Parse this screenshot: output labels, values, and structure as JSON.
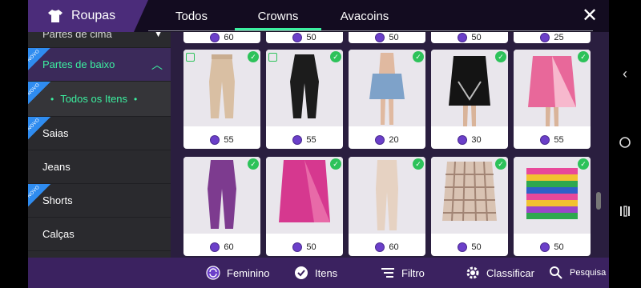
{
  "header": {
    "category_label": "Roupas",
    "tabs": [
      {
        "label": "Todos"
      },
      {
        "label": "Crowns"
      },
      {
        "label": "Avacoins"
      }
    ],
    "active_tab": "Crowns"
  },
  "sidebar": {
    "items": [
      {
        "label": "Partes de cima",
        "badge": "",
        "state": "collapsed"
      },
      {
        "label": "Partes de baixo",
        "badge": "NOVO",
        "state": "expanded"
      },
      {
        "label": "Todos os Itens",
        "badge": "NOVO",
        "state": "selected"
      },
      {
        "label": "Saias",
        "badge": "NOVO"
      },
      {
        "label": "Jeans",
        "badge": ""
      },
      {
        "label": "Shorts",
        "badge": "NOVO"
      },
      {
        "label": "Calças",
        "badge": ""
      }
    ]
  },
  "grid": {
    "partial_row_prices": [
      "60",
      "50",
      "50",
      "50",
      "25"
    ],
    "items": [
      {
        "price": "55",
        "owned": true,
        "tagged": true,
        "kind": "pants-beige"
      },
      {
        "price": "55",
        "owned": true,
        "tagged": true,
        "kind": "pants-black"
      },
      {
        "price": "20",
        "owned": true,
        "tagged": false,
        "kind": "skirt-denim"
      },
      {
        "price": "30",
        "owned": true,
        "tagged": false,
        "kind": "skirt-black"
      },
      {
        "price": "55",
        "owned": true,
        "tagged": false,
        "kind": "skirt-pink"
      },
      {
        "price": "60",
        "owned": true,
        "tagged": false,
        "kind": "pants-purple"
      },
      {
        "price": "50",
        "owned": true,
        "tagged": false,
        "kind": "sarong-pink"
      },
      {
        "price": "60",
        "owned": true,
        "tagged": false,
        "kind": "pants-cream"
      },
      {
        "price": "50",
        "owned": true,
        "tagged": false,
        "kind": "skirt-plaid"
      },
      {
        "price": "50",
        "owned": true,
        "tagged": false,
        "kind": "shorts-rainbow"
      }
    ]
  },
  "bottombar": {
    "gender_label": "Feminino",
    "items_label": "Itens",
    "filter_label": "Filtro",
    "sort_label": "Classificar",
    "search_label": "Pesquisa"
  },
  "colors": {
    "accent": "#3cf0a0",
    "header_bg": "#130c20",
    "category_bg": "#4b2c7a",
    "bottombar_bg": "#3b2260",
    "coin": "#6b3fc9",
    "check": "#2dc25a",
    "novo_badge": "#2f8cf0"
  }
}
